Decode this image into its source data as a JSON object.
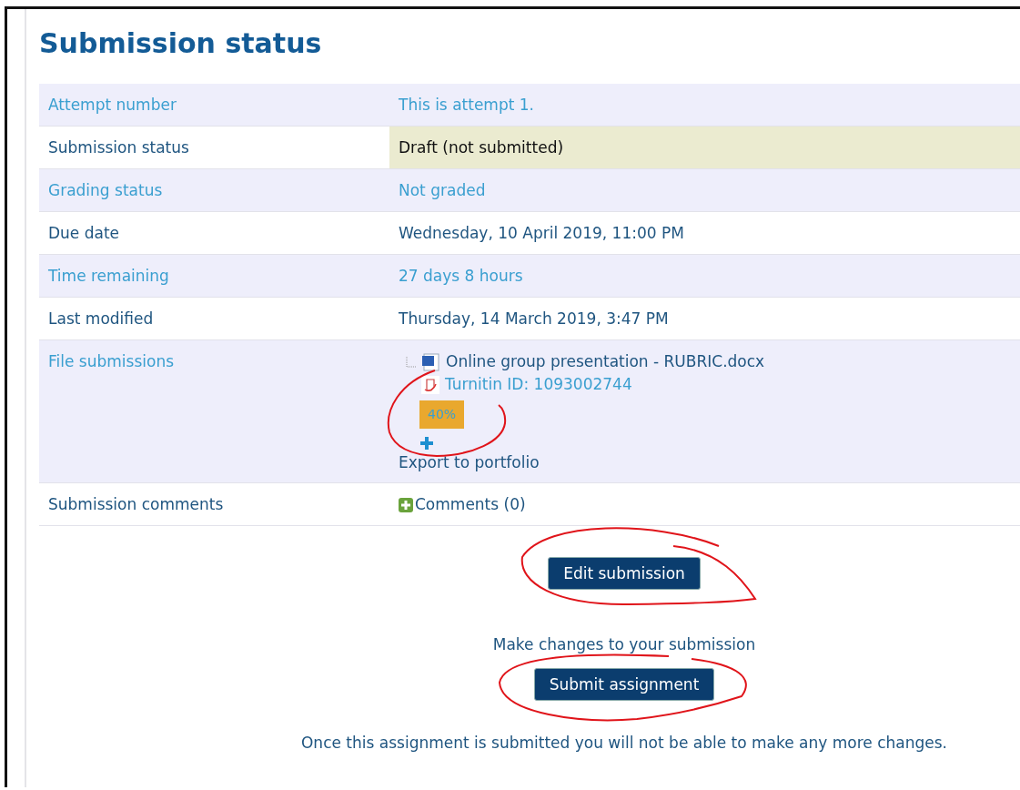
{
  "heading": "Submission status",
  "rows": [
    {
      "kind": "text",
      "striped": true,
      "label": "Attempt number",
      "value": "This is attempt 1."
    },
    {
      "kind": "status",
      "striped": false,
      "label": "Submission status",
      "value": "Draft (not submitted)"
    },
    {
      "kind": "text",
      "striped": true,
      "label": "Grading status",
      "value": "Not graded"
    },
    {
      "kind": "text",
      "striped": false,
      "label": "Due date",
      "value": "Wednesday, 10 April 2019, 11:00 PM"
    },
    {
      "kind": "text",
      "striped": true,
      "label": "Time remaining",
      "value": "27 days 8 hours"
    },
    {
      "kind": "text",
      "striped": false,
      "label": "Last modified",
      "value": "Thursday, 14 March 2019, 3:47 PM"
    },
    {
      "kind": "files",
      "striped": true,
      "label": "File submissions",
      "file_name": "Online group presentation - RUBRIC.docx",
      "turnitin": "Turnitin ID: 1093002744",
      "similarity": "40%",
      "export": "Export to portfolio"
    },
    {
      "kind": "comments",
      "striped": false,
      "label": "Submission comments",
      "value": "Comments (0)"
    }
  ],
  "actions": [
    {
      "button": "Edit submission",
      "note": "Make changes to your submission"
    },
    {
      "button": "Submit assignment",
      "note": "Once this assignment is submitted you will not be able to make any more changes."
    }
  ]
}
